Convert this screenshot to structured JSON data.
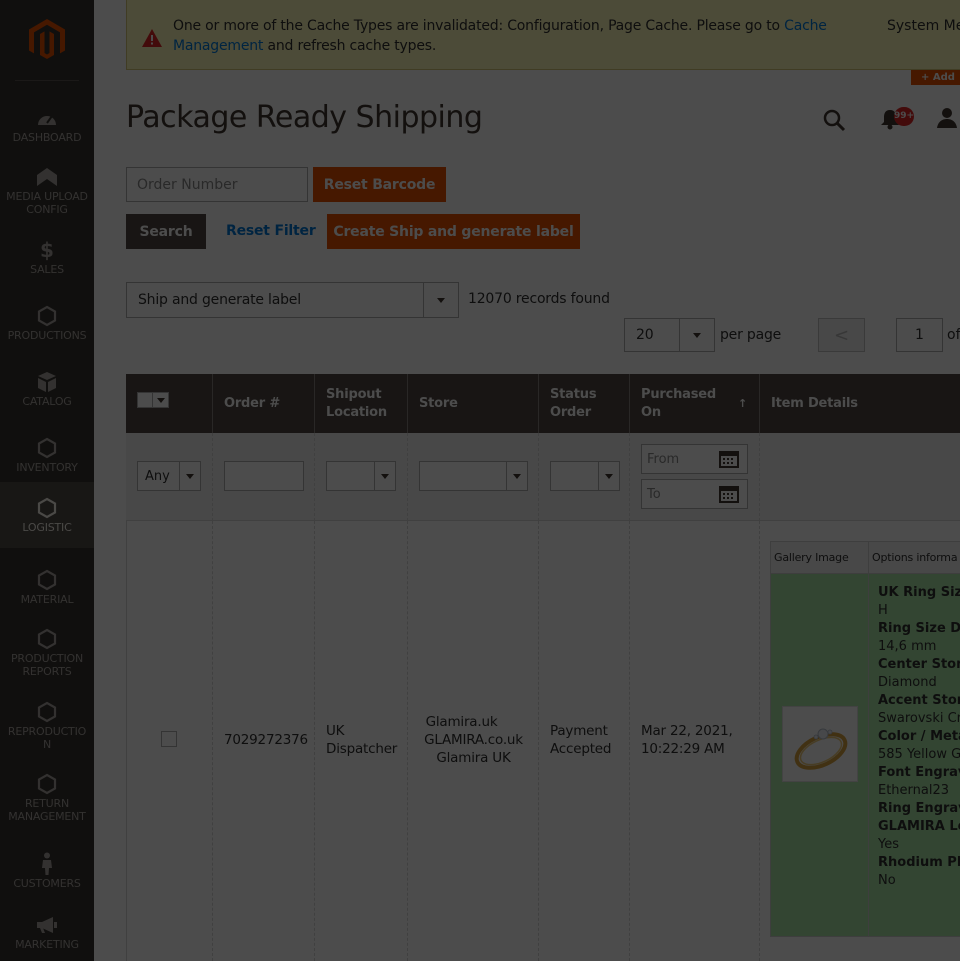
{
  "sidebar": {
    "items": [
      {
        "label": "DASHBOARD",
        "icon": "dashboard-icon"
      },
      {
        "label": "MEDIA UPLOAD CONFIG",
        "icon": "upload-icon"
      },
      {
        "label": "SALES",
        "icon": "dollar-icon"
      },
      {
        "label": "PRODUCTIONS",
        "icon": "hexagon-icon"
      },
      {
        "label": "CATALOG",
        "icon": "box-icon"
      },
      {
        "label": "INVENTORY",
        "icon": "hexagon-icon"
      },
      {
        "label": "LOGISTIC",
        "icon": "hexagon-icon",
        "active": true
      },
      {
        "label": "MATERIAL",
        "icon": "hexagon-icon"
      },
      {
        "label": "PRODUCTION REPORTS",
        "icon": "hexagon-icon"
      },
      {
        "label": "REPRODUCTION",
        "icon": "hexagon-icon"
      },
      {
        "label": "RETURN MANAGEMENT",
        "icon": "hexagon-icon"
      },
      {
        "label": "CUSTOMERS",
        "icon": "person-icon"
      },
      {
        "label": "MARKETING",
        "icon": "megaphone-icon"
      }
    ]
  },
  "notice": {
    "text_before": "One or more of the Cache Types are invalidated: Configuration, Page Cache. Please go to ",
    "link": "Cache Management",
    "text_after": " and refresh cache types.",
    "right_text": "System Me"
  },
  "add_tag": "+ Add",
  "header": {
    "title": "Package Ready Shipping",
    "notification_count": "99+"
  },
  "search": {
    "order_placeholder": "Order Number",
    "reset_barcode": "Reset Barcode",
    "search": "Search",
    "reset_filter": "Reset Filter",
    "create_ship": "Create Ship and generate label"
  },
  "toolbar": {
    "action_value": "Ship and generate label",
    "records": "12070 records found",
    "per_page_value": "20",
    "per_page_label": "per page",
    "prev": "<",
    "page": "1",
    "of": "of"
  },
  "grid": {
    "columns": [
      "Order #",
      "Shipout Location",
      "Store",
      "Status Order",
      "Purchased On",
      "Item Details"
    ],
    "sort_indicator": "↑",
    "filters": {
      "any": "Any",
      "from": "From",
      "to": "To"
    },
    "row": {
      "order": "7029272376",
      "shipout": "UK Dispatcher",
      "store": [
        "Glamira.uk",
        "GLAMIRA.co.uk",
        "Glamira UK"
      ],
      "status": "Payment Accepted",
      "purchased": "Mar 22, 2021, 10:22:29 AM",
      "details": {
        "headers": [
          "Gallery Image",
          "Options informa"
        ],
        "options": [
          {
            "k": "UK Ring Size",
            "v": "H"
          },
          {
            "k": "Ring Size Dia",
            "v": "14,6 mm"
          },
          {
            "k": "Center Stone",
            "v": "Diamond"
          },
          {
            "k": "Accent Stone",
            "v": "Swarovski Cr"
          },
          {
            "k": "Color / Meta",
            "v": "585 Yellow G"
          },
          {
            "k": "Font Engrav",
            "v": "Ethernal23"
          },
          {
            "k": "Ring Engrav",
            "v": ""
          },
          {
            "k": "GLAMIRA Lo",
            "v": "Yes"
          },
          {
            "k": "Rhodium Pl",
            "v": "No"
          }
        ]
      }
    }
  }
}
